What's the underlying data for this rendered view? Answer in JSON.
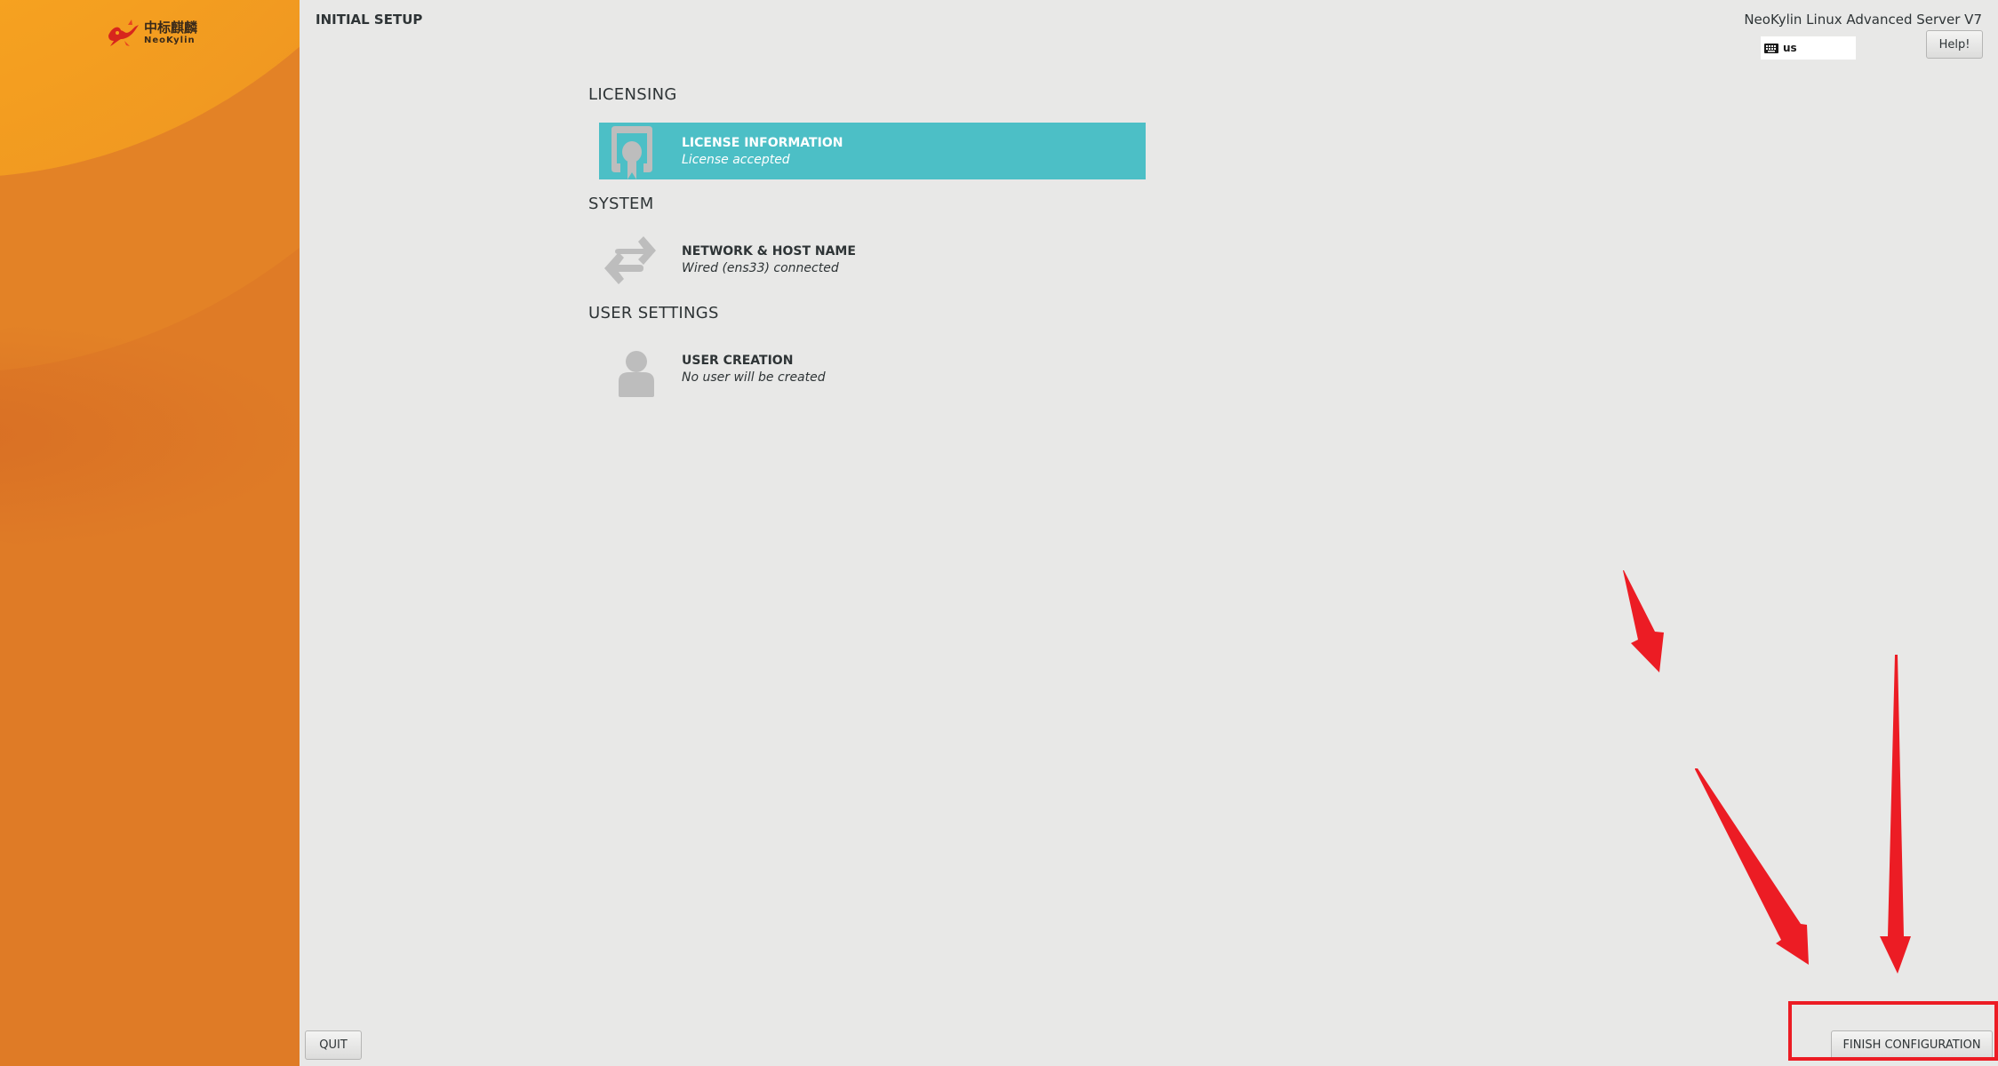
{
  "sidebar": {
    "logo": {
      "chinese_text": "中标麒麟",
      "english_text": "NeoKylin",
      "icon": "kylin-dragon-logo"
    }
  },
  "header": {
    "title": "INITIAL SETUP",
    "product": "NeoKylin Linux Advanced Server V7",
    "keyboard_layout": "us",
    "keyboard_icon": "keyboard-icon",
    "help_label": "Help!"
  },
  "sections": [
    {
      "title": "LICENSING",
      "spokes": [
        {
          "name": "LICENSE INFORMATION",
          "status": "License accepted",
          "icon": "license-icon",
          "selected": true
        }
      ]
    },
    {
      "title": "SYSTEM",
      "spokes": [
        {
          "name": "NETWORK & HOST NAME",
          "status": "Wired (ens33) connected",
          "icon": "network-arrows-icon",
          "selected": false
        }
      ]
    },
    {
      "title": "USER SETTINGS",
      "spokes": [
        {
          "name": "USER CREATION",
          "status": "No user will be created",
          "icon": "user-icon",
          "selected": false
        }
      ]
    }
  ],
  "footer": {
    "quit_label": "QUIT",
    "finish_label": "FINISH CONFIGURATION"
  },
  "colors": {
    "sidebar_orange": "#df7b26",
    "selected_spoke": "#4cbfc6",
    "annotation_red": "#ec1c24",
    "background": "#e8e8e7"
  },
  "annotations": {
    "arrow_count": 3,
    "highlight_target": "FINISH CONFIGURATION"
  }
}
